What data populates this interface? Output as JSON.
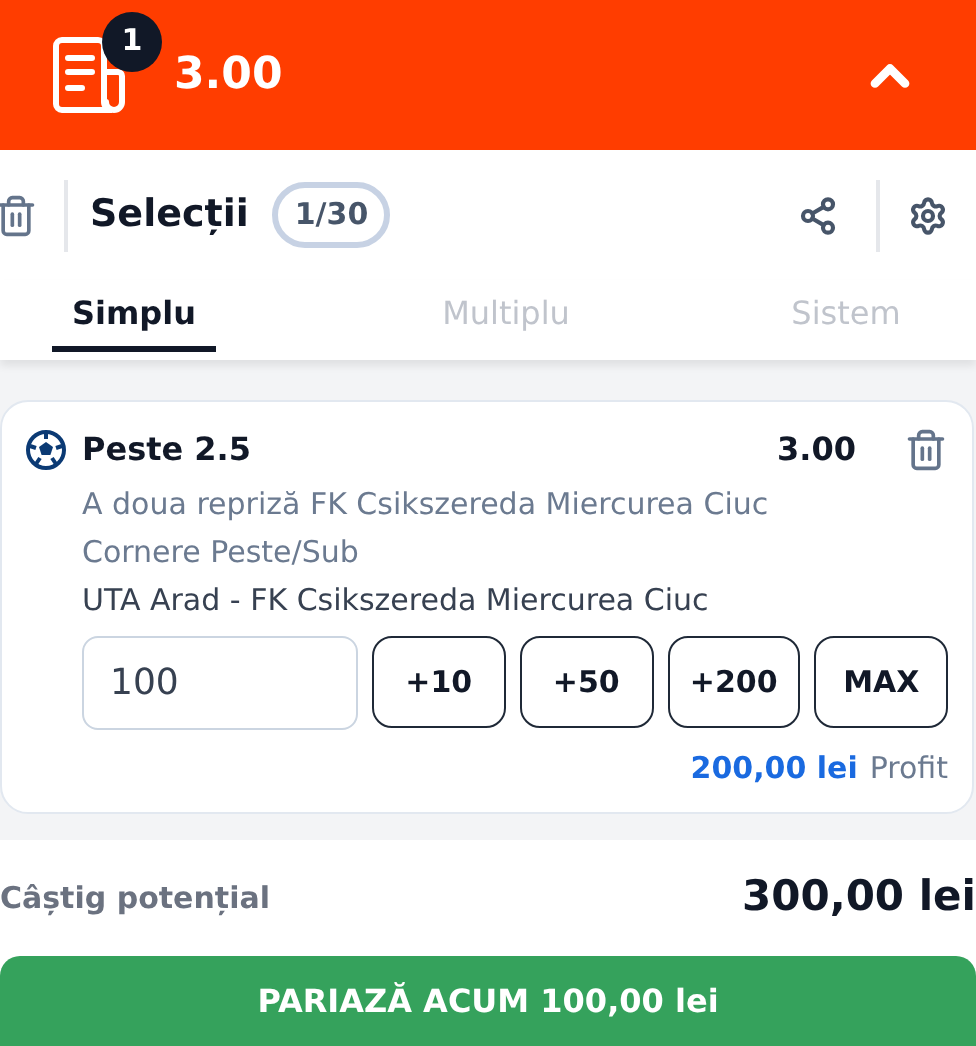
{
  "header": {
    "badge": "1",
    "odds": "3.00"
  },
  "selections": {
    "title": "Selecții",
    "count": "1/30"
  },
  "tabs": [
    {
      "label": "Simplu",
      "selected": true
    },
    {
      "label": "Multiplu",
      "selected": false
    },
    {
      "label": "Sistem",
      "selected": false
    }
  ],
  "bet": {
    "market": "Peste 2.5",
    "odds": "3.00",
    "lines": [
      "A doua repriză FK Csikszereda Miercurea Ciuc",
      "Cornere Peste/Sub"
    ],
    "match": "UTA Arad - FK Csikszereda Miercurea Ciuc",
    "stake": "100",
    "quick_amounts": [
      "+10",
      "+50",
      "+200",
      "MAX"
    ],
    "profit_value": "200,00 lei",
    "profit_label": "Profit"
  },
  "potential": {
    "label": "Câștig potențial",
    "value": "300,00 lei"
  },
  "place_bet": "PARIAZĂ ACUM 100,00 lei"
}
